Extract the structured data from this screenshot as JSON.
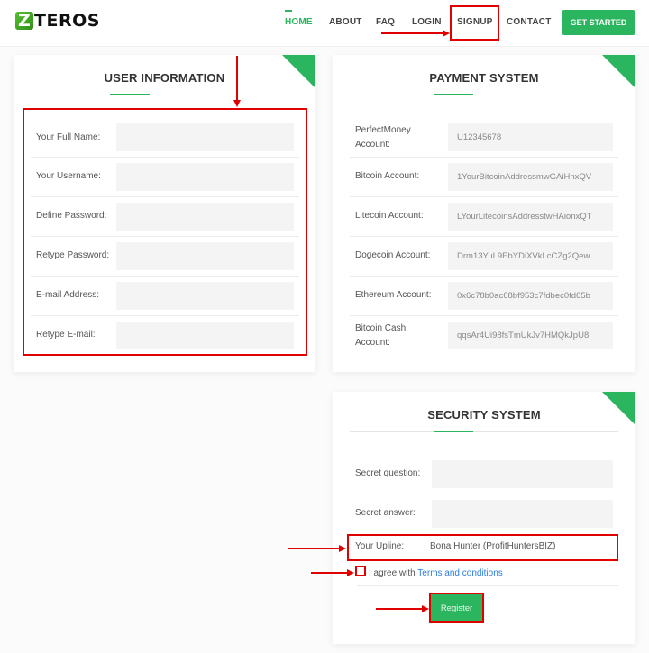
{
  "brand": {
    "logo_letter": "Z",
    "logo_text": "TEROS",
    "accent_color": "#2bb55f",
    "annotation_color": "#e10000"
  },
  "nav": {
    "items": [
      {
        "label": "HOME",
        "active": true
      },
      {
        "label": "ABOUT",
        "active": false
      },
      {
        "label": "FAQ",
        "active": false
      },
      {
        "label": "LOGIN",
        "active": false
      },
      {
        "label": "SIGNUP",
        "active": false
      },
      {
        "label": "CONTACT",
        "active": false
      }
    ],
    "cta_label": "GET STARTED"
  },
  "user_info": {
    "title": "USER INFORMATION",
    "fields": [
      {
        "label": "Your Full Name:",
        "value": ""
      },
      {
        "label": "Your Username:",
        "value": ""
      },
      {
        "label": "Define Password:",
        "value": ""
      },
      {
        "label": "Retype Password:",
        "value": ""
      },
      {
        "label": "E-mail Address:",
        "value": ""
      },
      {
        "label": "Retype E-mail:",
        "value": ""
      }
    ]
  },
  "payment": {
    "title": "PAYMENT SYSTEM",
    "fields": [
      {
        "label_line1": "PerfectMoney",
        "label_line2": "Account:",
        "value": "U12345678"
      },
      {
        "label_line1": "Bitcoin Account:",
        "label_line2": "",
        "value": "1YourBitcoinAddressmwGAiHnxQV"
      },
      {
        "label_line1": "Litecoin Account:",
        "label_line2": "",
        "value": "LYourLitecoinsAddresstwHAionxQT"
      },
      {
        "label_line1": "Dogecoin Account:",
        "label_line2": "",
        "value": "Drm13YuL9EbYDiXVkLcCZg2Qew"
      },
      {
        "label_line1": "Ethereum Account:",
        "label_line2": "",
        "value": "0x6c78b0ac68bf953c7fdbec0fd65b"
      },
      {
        "label_line1": "Bitcoin Cash",
        "label_line2": "Account:",
        "value": "qqsAr4Ui98fsTmUkJv7HMQkJpU8"
      }
    ]
  },
  "security": {
    "title": "SECURITY SYSTEM",
    "fields": [
      {
        "label": "Secret question:",
        "value": ""
      },
      {
        "label": "Secret answer:",
        "value": ""
      }
    ],
    "upline_label": "Your Upline:",
    "upline_value": "Bona Hunter (ProfitHuntersBIZ)",
    "agree_prefix": "I agree with ",
    "agree_link": "Terms and conditions",
    "agree_checked": false,
    "register_label": "Register"
  }
}
